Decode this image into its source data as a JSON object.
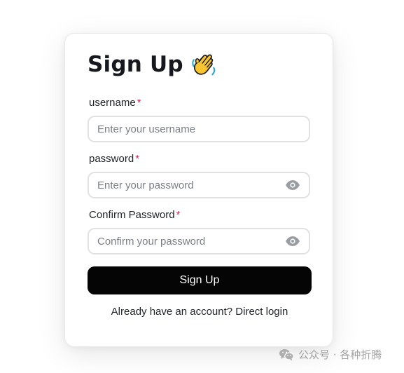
{
  "form": {
    "title": "Sign Up",
    "title_icon": "waving-hand-icon",
    "username": {
      "label": "username",
      "required_mark": "*",
      "placeholder": "Enter your username",
      "value": ""
    },
    "password": {
      "label": "password",
      "required_mark": "*",
      "placeholder": "Enter your password",
      "value": "",
      "toggle_icon": "eye-icon"
    },
    "confirm_password": {
      "label": "Confirm Password",
      "required_mark": "*",
      "placeholder": "Confirm your password",
      "value": "",
      "toggle_icon": "eye-icon"
    },
    "submit_label": "Sign Up",
    "footer": {
      "prompt": "Already have an account?",
      "link": "Direct login"
    }
  },
  "watermark": {
    "icon": "wechat-icon",
    "text": "公众号 · 各种折腾"
  },
  "colors": {
    "button_bg": "#050505",
    "required": "#e0245e",
    "border": "#e2e2e2",
    "placeholder": "#7b7f86"
  }
}
